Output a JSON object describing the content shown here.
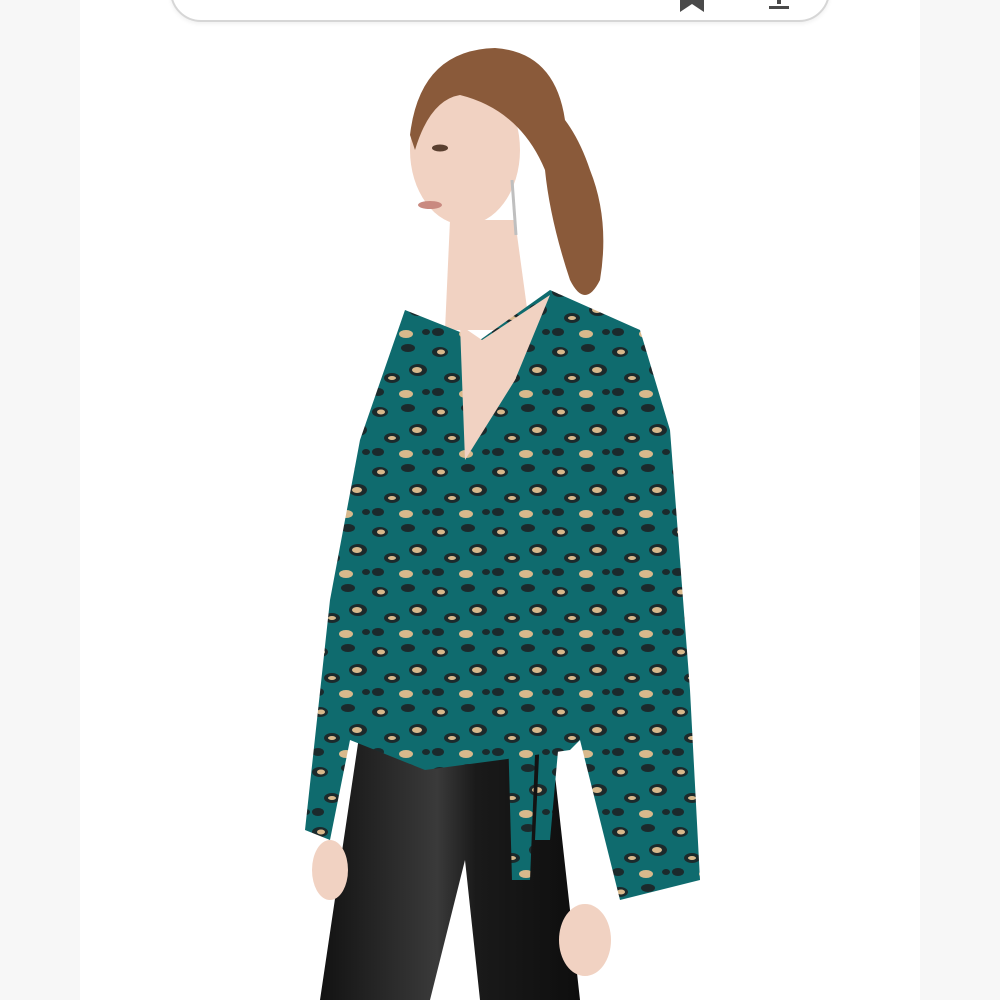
{
  "search": {
    "query_text": "",
    "bookmark_icon": "bookmark-icon",
    "share_icon": "share-icon"
  },
  "product_image": {
    "subject": "model-wearing-teal-leopard-wrap-top",
    "colors": {
      "top_base": "#0f6b6e",
      "spots_dark": "#1b2a2c",
      "spots_light": "#d8b98c",
      "pants": "#1a1a1a",
      "hair": "#8a5a3a",
      "skin": "#f1d2c2",
      "background": "#ffffff"
    }
  }
}
